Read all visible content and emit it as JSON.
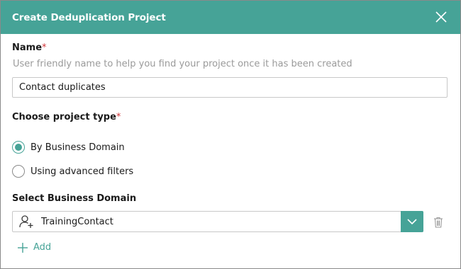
{
  "dialog": {
    "title": "Create Deduplication Project",
    "close_icon": "close-icon"
  },
  "name_section": {
    "label": "Name",
    "required_marker": "*",
    "hint": "User friendly name to help you find your project once it has been created",
    "value": "Contact duplicates"
  },
  "project_type": {
    "label": "Choose project type",
    "required_marker": "*",
    "options": [
      {
        "label": "By Business Domain",
        "selected": true
      },
      {
        "label": "Using advanced filters",
        "selected": false
      }
    ]
  },
  "business_domain": {
    "label": "Select Business Domain",
    "selected_value": "TrainingContact",
    "icon": "add-user-icon",
    "dropdown_icon": "chevron-down-icon",
    "delete_icon": "trash-icon"
  },
  "add_action": {
    "label": "Add",
    "icon": "plus-icon"
  },
  "colors": {
    "accent": "#46a397",
    "required": "#d13438",
    "hint_text": "#9a9a9a"
  }
}
